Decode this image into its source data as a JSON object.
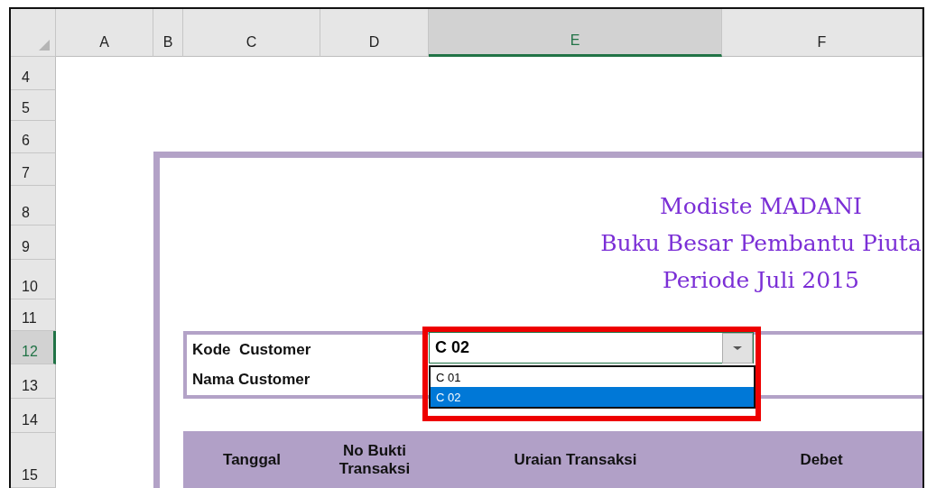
{
  "columns": [
    {
      "label": "A",
      "selected": false
    },
    {
      "label": "B",
      "selected": false
    },
    {
      "label": "C",
      "selected": false
    },
    {
      "label": "D",
      "selected": false
    },
    {
      "label": "E",
      "selected": true
    },
    {
      "label": "F",
      "selected": false
    }
  ],
  "rows": [
    {
      "label": "4",
      "selected": false
    },
    {
      "label": "5",
      "selected": false
    },
    {
      "label": "6",
      "selected": false
    },
    {
      "label": "7",
      "selected": false
    },
    {
      "label": "8",
      "selected": false
    },
    {
      "label": "9",
      "selected": false
    },
    {
      "label": "10",
      "selected": false
    },
    {
      "label": "11",
      "selected": false
    },
    {
      "label": "12",
      "selected": true
    },
    {
      "label": "13",
      "selected": false
    },
    {
      "label": "14",
      "selected": false
    },
    {
      "label": "15",
      "selected": false
    }
  ],
  "title_lines": [
    "Modiste MADANI",
    "Buku Besar Pembantu Piuta",
    "Periode Juli 2015"
  ],
  "customer": {
    "kode_label": "Kode  Customer",
    "nama_label": "Nama Customer",
    "kode_value": "C 02",
    "dropdown_options": [
      {
        "label": "C 01",
        "selected": false
      },
      {
        "label": "C 02",
        "selected": true
      }
    ]
  },
  "table_headers": [
    "Tanggal",
    "No Bukti Transaksi",
    "Uraian Transaksi",
    "Debet"
  ]
}
